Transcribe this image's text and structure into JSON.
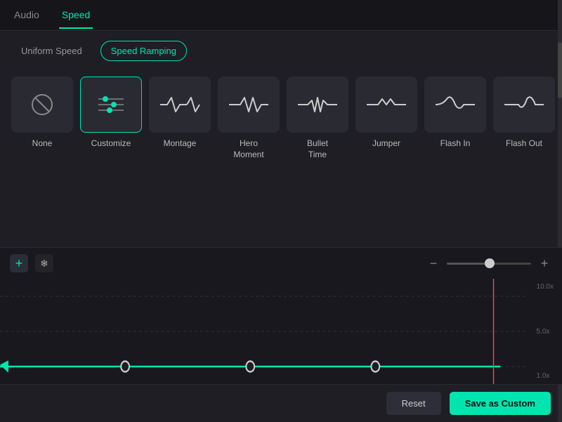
{
  "tabs": [
    {
      "id": "audio",
      "label": "Audio",
      "active": false
    },
    {
      "id": "speed",
      "label": "Speed",
      "active": true
    }
  ],
  "modes": [
    {
      "id": "uniform",
      "label": "Uniform Speed",
      "active": false
    },
    {
      "id": "ramping",
      "label": "Speed Ramping",
      "active": true
    }
  ],
  "presets": [
    {
      "id": "none",
      "label": "None",
      "selected": false,
      "icon": "none"
    },
    {
      "id": "customize",
      "label": "Customize",
      "selected": true,
      "icon": "customize"
    },
    {
      "id": "montage",
      "label": "Montage",
      "selected": false,
      "icon": "montage"
    },
    {
      "id": "hero_moment",
      "label": "Hero\nMoment",
      "selected": false,
      "icon": "hero_moment"
    },
    {
      "id": "bullet_time",
      "label": "Bullet\nTime",
      "selected": false,
      "icon": "bullet_time"
    },
    {
      "id": "jumper",
      "label": "Jumper",
      "selected": false,
      "icon": "jumper"
    },
    {
      "id": "flash_in",
      "label": "Flash In",
      "selected": false,
      "icon": "flash_in"
    },
    {
      "id": "flash_out",
      "label": "Flash Out",
      "selected": false,
      "icon": "flash_out"
    }
  ],
  "graph": {
    "labels": [
      "10.0x",
      "5.0x",
      "1.0x"
    ]
  },
  "toolbar": {
    "add_label": "+",
    "snowflake_label": "❄",
    "zoom_minus": "−",
    "zoom_plus": "+"
  },
  "buttons": {
    "reset": "Reset",
    "save_custom": "Save as Custom"
  }
}
